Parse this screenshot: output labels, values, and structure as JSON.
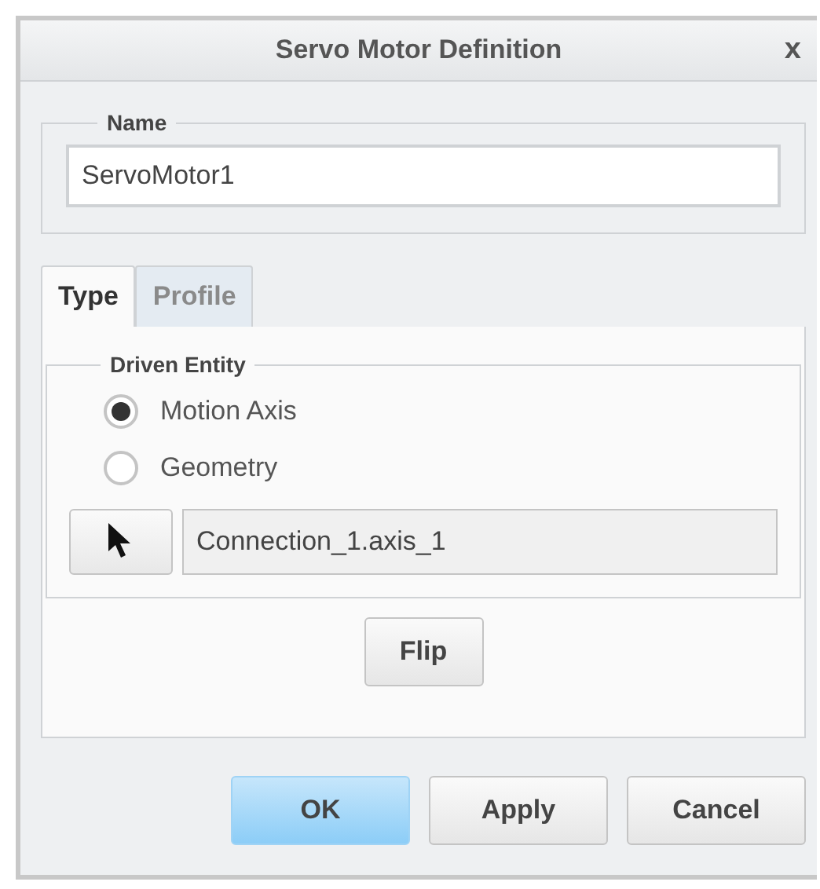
{
  "window": {
    "title": "Servo Motor Definition",
    "close": "x"
  },
  "name_group": {
    "label": "Name",
    "value": "ServoMotor1"
  },
  "tabs": [
    {
      "label": "Type",
      "selected": true
    },
    {
      "label": "Profile",
      "selected": false
    }
  ],
  "driven_entity": {
    "label": "Driven Entity",
    "options": [
      {
        "label": "Motion Axis",
        "selected": true
      },
      {
        "label": "Geometry",
        "selected": false
      }
    ],
    "reference": "Connection_1.axis_1"
  },
  "flip_button": "Flip",
  "buttons": [
    {
      "label": "OK",
      "kind": "primary"
    },
    {
      "label": "Apply",
      "kind": "normal"
    },
    {
      "label": "Cancel",
      "kind": "normal"
    }
  ]
}
